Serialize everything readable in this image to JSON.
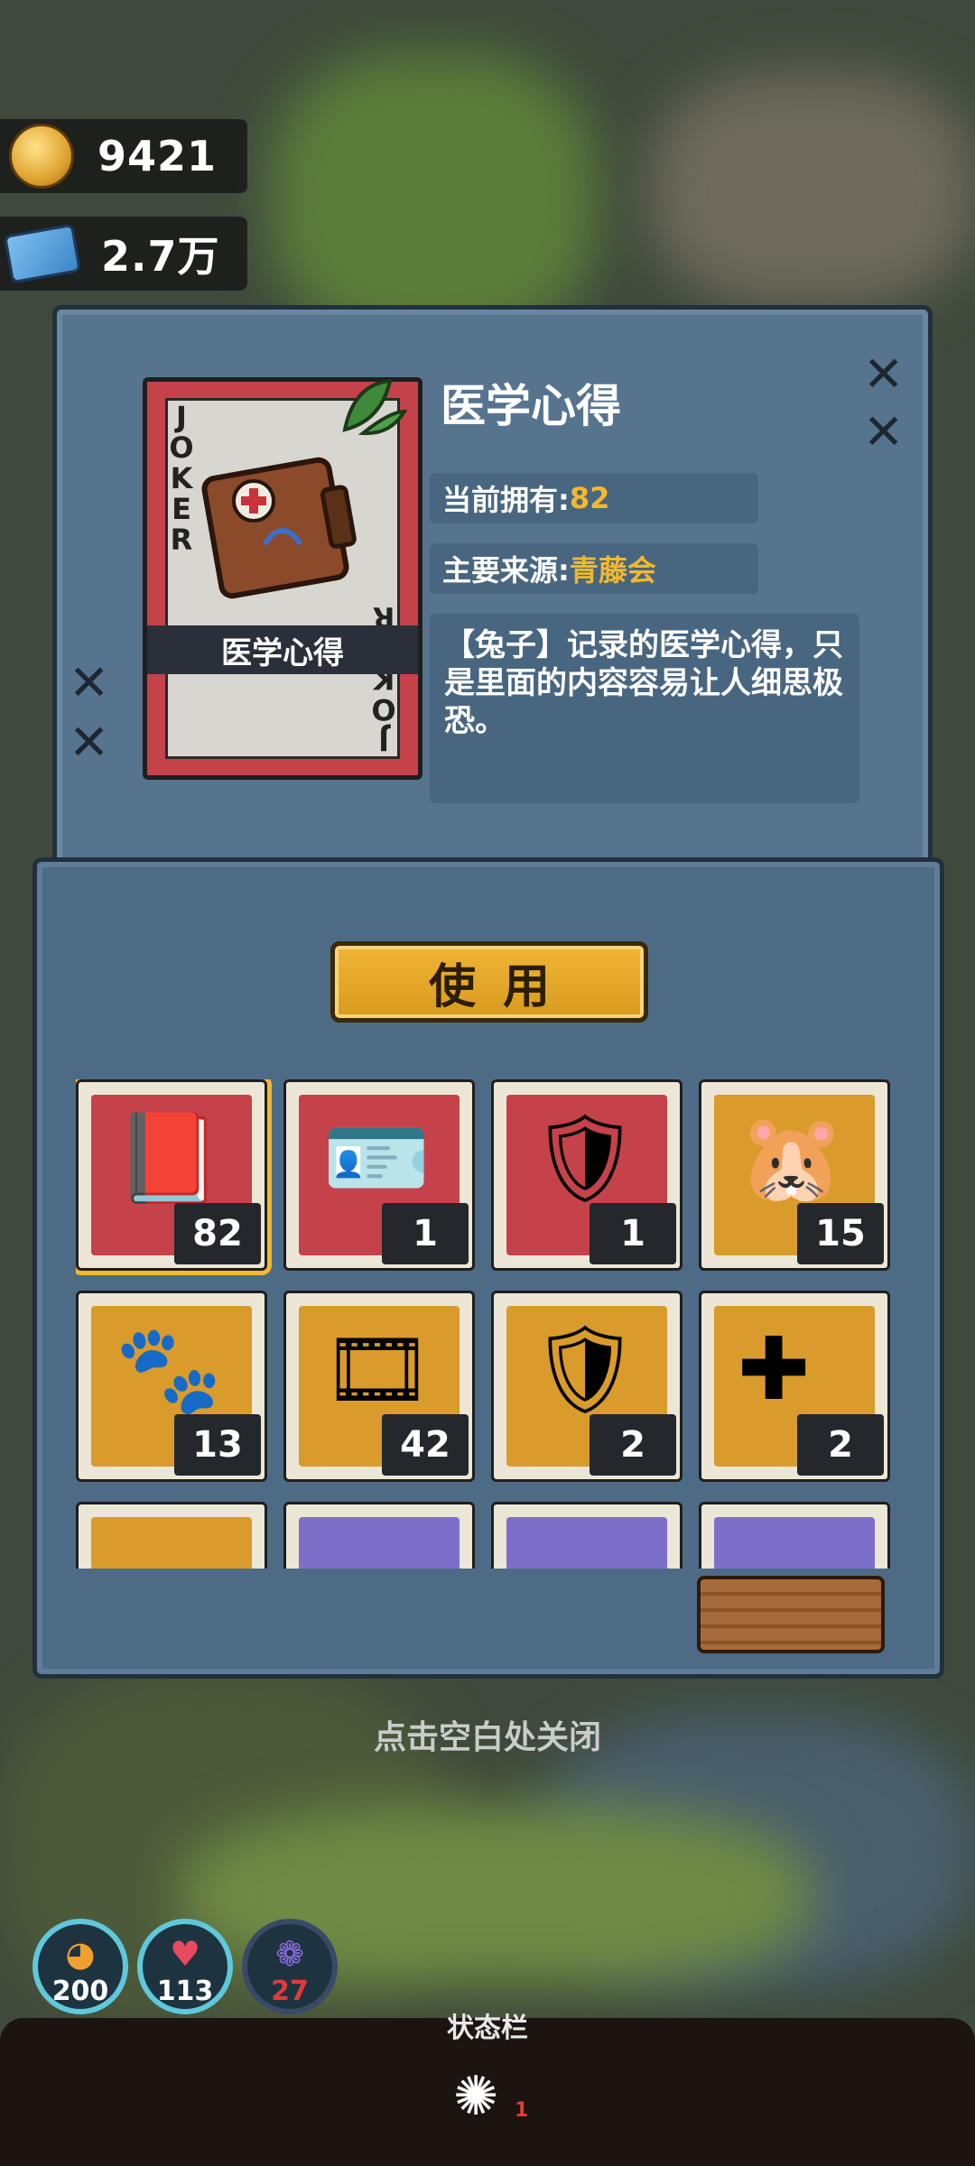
{
  "currency": {
    "coins": "9421",
    "coin_icon": "gold-coin-icon",
    "tickets": "2.7万",
    "ticket_icon": "blue-ticket-icon"
  },
  "detail": {
    "card_joker_text": "JOKER",
    "card_joker_text_rev": "JOKER",
    "card_label": "医学心得",
    "title": "医学心得",
    "owned_label": "当前拥有:",
    "owned_value": "82",
    "source_label": "主要来源:",
    "source_value": "青藤会",
    "description": "【兔子】记录的医学心得，只是里面的内容容易让人细思极恐。"
  },
  "use_button": "使用",
  "inventory": [
    {
      "icon": "medical-notebook-icon",
      "count": "82",
      "bg": "red",
      "selected": true
    },
    {
      "icon": "id-card-icon",
      "count": "1",
      "bg": "red"
    },
    {
      "icon": "gold-badge-icon",
      "count": "1",
      "bg": "red"
    },
    {
      "icon": "capybara-bag-icon",
      "count": "15",
      "bg": "orange"
    },
    {
      "icon": "paw-map-icon",
      "count": "13",
      "bg": "orange"
    },
    {
      "icon": "film-reel-icon",
      "count": "42",
      "bg": "orange"
    },
    {
      "icon": "gold-badge-star-icon",
      "count": "2",
      "bg": "orange"
    },
    {
      "icon": "medical-card-icon",
      "count": "2",
      "bg": "orange"
    },
    {
      "icon": "item-icon",
      "count": "",
      "bg": "orange"
    },
    {
      "icon": "item-icon",
      "count": "",
      "bg": "purple"
    },
    {
      "icon": "item-icon",
      "count": "",
      "bg": "purple"
    },
    {
      "icon": "item-icon",
      "count": "",
      "bg": "purple"
    }
  ],
  "close_hint": "点击空白处关闭",
  "stats": [
    {
      "icon": "stamina-icon",
      "value": "200"
    },
    {
      "icon": "heart-icon",
      "value": "113"
    },
    {
      "icon": "brain-icon",
      "value": "27"
    }
  ],
  "status_bar_label": "状态栏",
  "status_bar_sub": "1"
}
